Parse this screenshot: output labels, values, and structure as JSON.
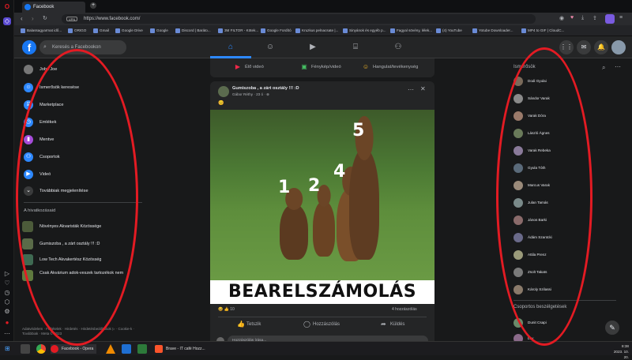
{
  "browser": {
    "tab_title": "Facebook",
    "url": "https://www.facebook.com/",
    "vpn_badge": "VPN",
    "bookmarks": [
      "Balassagyarmat idő...",
      "ORIGO",
      "Gmail",
      "Google Drive",
      "Google",
      "Discord | Baráto...",
      "3M FILTOR - Kötek...",
      "Google Fordító",
      "Kruzkus pelnacsate |...",
      "Sinyánok és egyéb p...",
      "Fagyal sövény, lélek...",
      "(4) YouTube",
      "Yotube Downloader...",
      "MP4 to GIF | CloudC..."
    ]
  },
  "fb_header": {
    "logo": "f",
    "search_placeholder": "Keresés a Facebookon"
  },
  "left_sidebar": {
    "profile_name": "Jobs Joe",
    "items": [
      {
        "label": "Ismerősök keresése",
        "icon": "friends-icon",
        "color": "#2d88ff"
      },
      {
        "label": "Marketplace",
        "icon": "marketplace-icon",
        "color": "#2d88ff"
      },
      {
        "label": "Emlékek",
        "icon": "memories-icon",
        "color": "#2d88ff"
      },
      {
        "label": "Mentve",
        "icon": "saved-icon",
        "color": "#a64cda"
      },
      {
        "label": "Csoportok",
        "icon": "groups-icon",
        "color": "#2d88ff"
      },
      {
        "label": "Videó",
        "icon": "video-icon",
        "color": "#2d88ff"
      },
      {
        "label": "Továbbiak megjelenítése",
        "icon": "chevron-down-icon",
        "color": "#3a3b3c"
      }
    ],
    "shortcuts_header": "A hivatkozásaid",
    "shortcuts": [
      "Növényes Akvaristák Közössége",
      "Gumiszoba , a zárt osztály !!! :D",
      "Low Tech Akvakertész Közösség",
      "Csak Akvárium adok-veszek tartozékok nem"
    ],
    "footer": "Adatvédelem · Feltételek · Hirdetés · Hirdetésbeállítások ▷ · Cookie-k · Továbbiak · Meta © 2023"
  },
  "composer": {
    "live": "Élő videó",
    "photo": "Fénykép/videó",
    "feeling": "Hangulat/tevékenység"
  },
  "post": {
    "group": "Gumiszoba , a zárt osztály !!! :D",
    "author_line": "Gábor Réthy · 23 ó · ⊕",
    "text": "😊",
    "labels": [
      "1",
      "2",
      "4",
      "5"
    ],
    "caption": "BEARELSZÁMOLÁS",
    "reactions_count": "10",
    "comments_count": "4 hozzászólás",
    "actions": {
      "like": "Tetszik",
      "comment": "Hozzászólás",
      "share": "Küldés"
    },
    "comment_placeholder": "Hozzászólás írása..."
  },
  "right_sidebar": {
    "contacts_header": "Ismerősök",
    "contacts": [
      "Dodi Gyulai",
      "Sándor Varak",
      "Varak Dóra",
      "László Ágnes",
      "Varak Rebeka",
      "Gyula Tóth",
      "Marcus Varak",
      "Julan Tamás",
      "János Barki",
      "Ádám Szantcki",
      "Attila Prenz",
      "Zsolt Takats",
      "Károly Szilassi"
    ],
    "group_chats_header": "Csoportos beszélgetések",
    "group_chats": [
      "Dunit Csapi",
      "Lev"
    ]
  },
  "taskbar": {
    "items": [
      "Facebook - Opera",
      "Brave - IT café Hozz..."
    ],
    "time": "8:38",
    "date": "2023. 10. 20."
  }
}
